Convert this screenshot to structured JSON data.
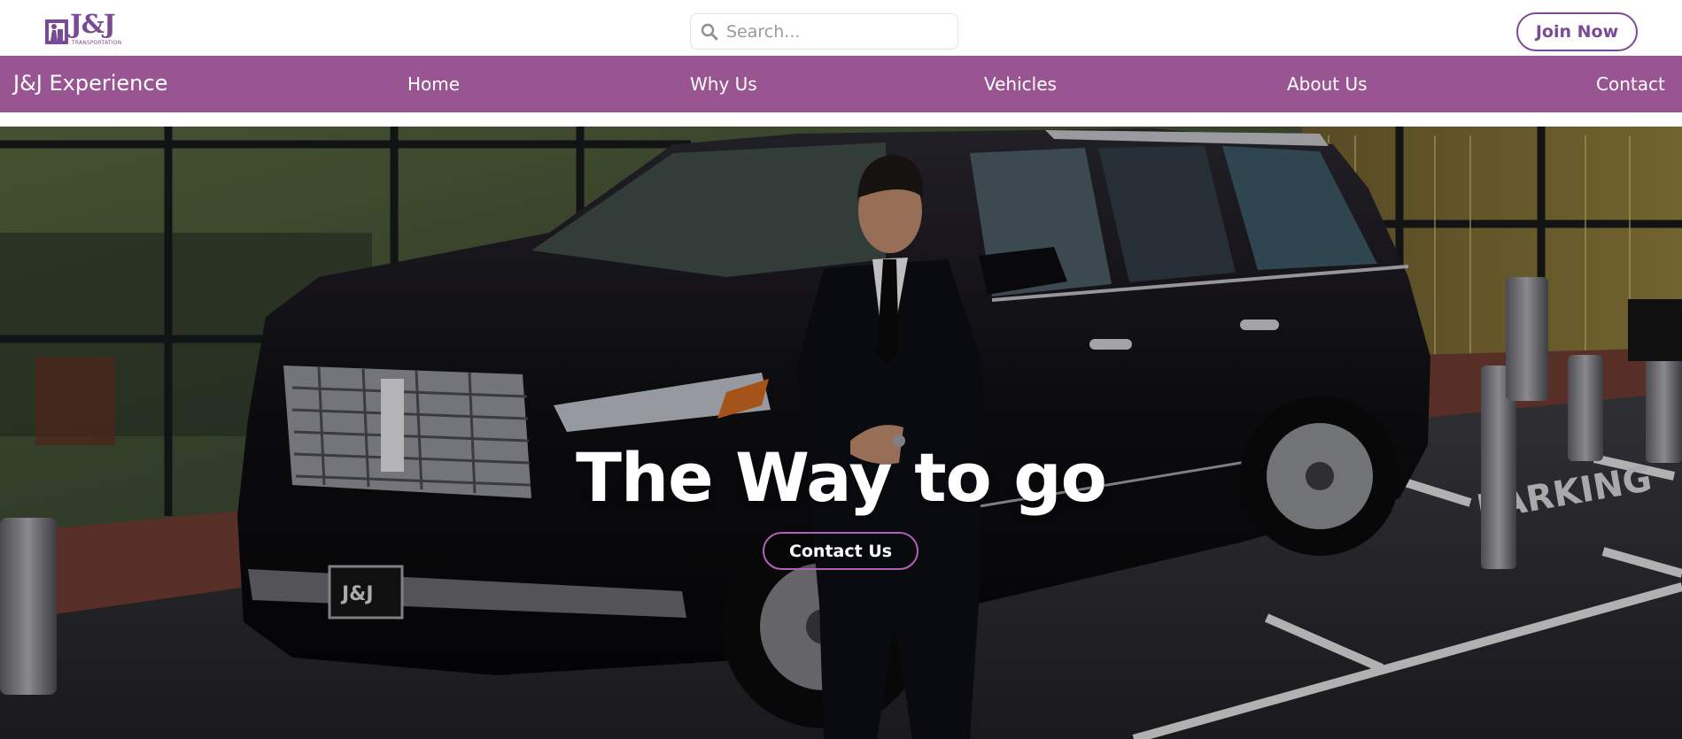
{
  "header": {
    "logo_text": "J&J",
    "logo_subtext": "TRANSPORTATION",
    "search_placeholder": "Search...",
    "join_label": "Join Now"
  },
  "nav": {
    "brand": "J&J Experience",
    "links": [
      "Home",
      "Why Us",
      "Vehicles",
      "About Us",
      "Contact"
    ]
  },
  "hero": {
    "title": "The Way to go",
    "cta_label": "Contact Us",
    "plate_text": "J&J",
    "ground_text": "PARKING"
  },
  "colors": {
    "brand_purple": "#7b4a95",
    "nav_purple": "#985592",
    "cta_border": "#b361b8"
  },
  "icons": [
    "logo-mark-icon",
    "search-icon"
  ]
}
